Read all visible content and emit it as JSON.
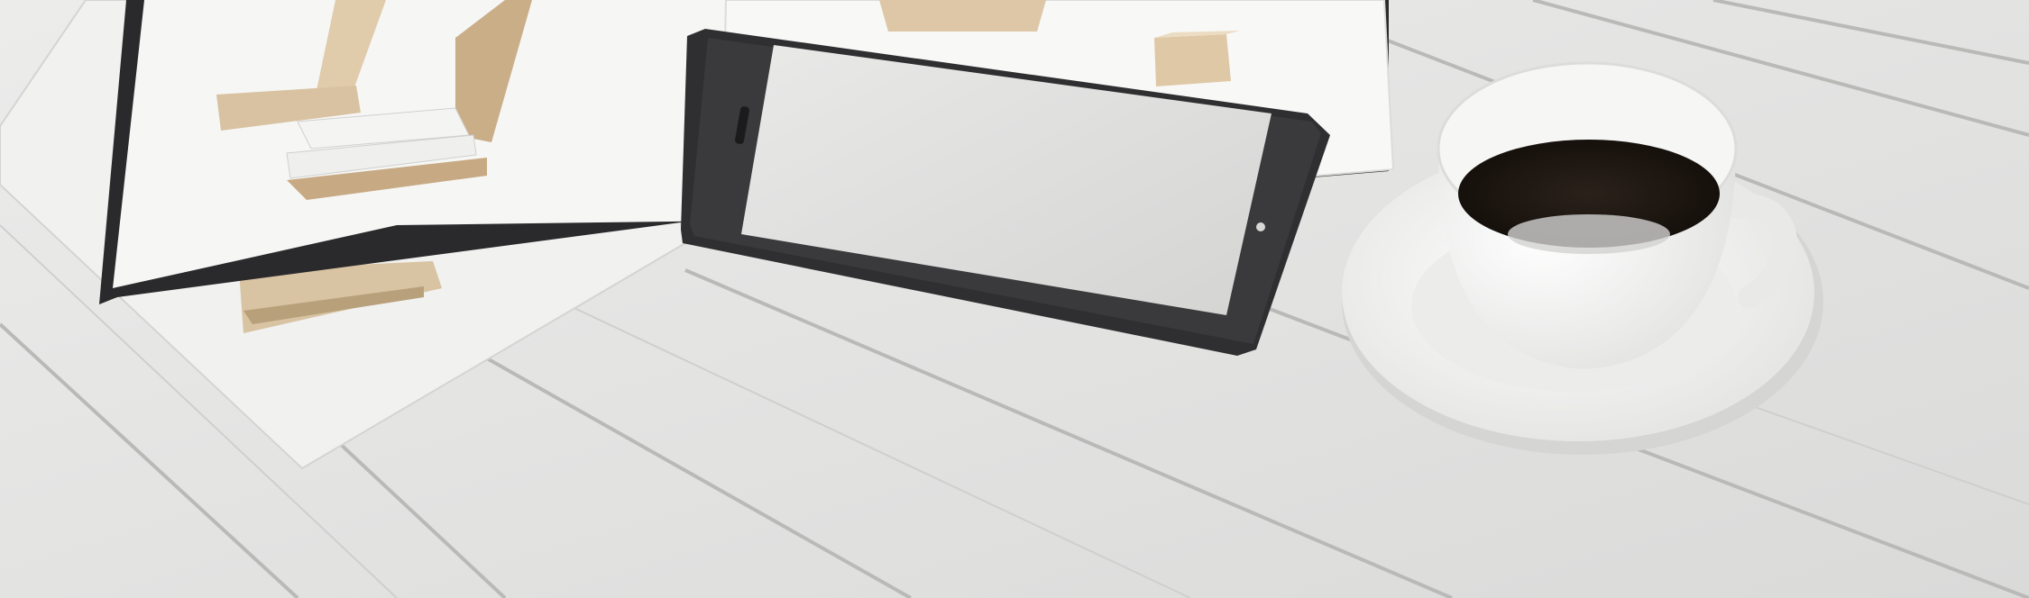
{
  "image": {
    "kind": "photo",
    "subject": "workspace-flatlay",
    "objects": [
      "wooden-table",
      "magazine",
      "loose-papers",
      "tablet",
      "coffee-cup",
      "saucer"
    ]
  },
  "colors": {
    "table": "#e6e6e5",
    "table_seam": "#b8b8b6",
    "paper": "#f3f3f2",
    "magazine_spine": "#2a2a2c",
    "tablet_body": "#2f2f31",
    "tablet_screen": "#dcdcdb",
    "coffee": "#1f1812",
    "cup": "#f2f2f1",
    "wood_block": "#d9c2a1"
  }
}
